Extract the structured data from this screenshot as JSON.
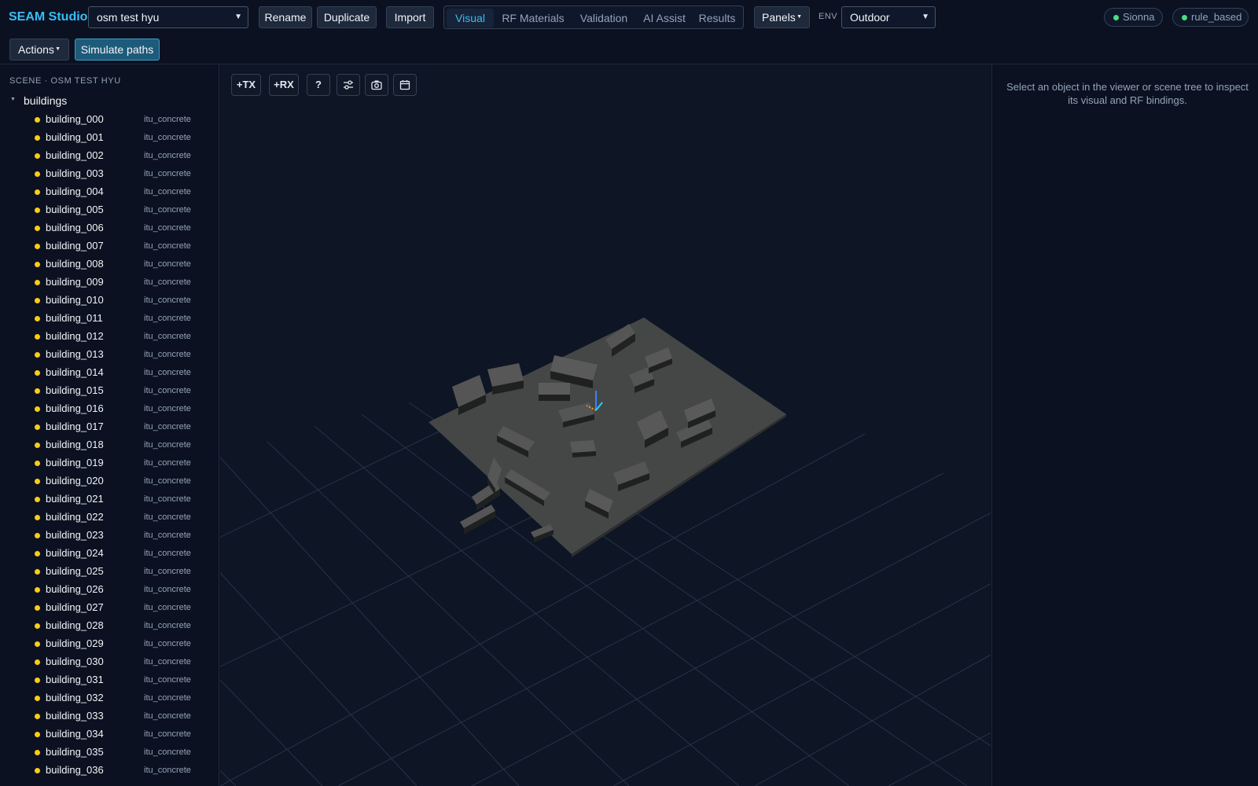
{
  "app": {
    "title": "SEAM Studio"
  },
  "scene_select": {
    "value": "osm test hyu"
  },
  "toolbar": {
    "rename": "Rename",
    "duplicate": "Duplicate",
    "import": "Import",
    "panels": "Panels",
    "actions": "Actions",
    "simulate": "Simulate paths"
  },
  "tabs": [
    {
      "label": "Visual",
      "active": true
    },
    {
      "label": "RF Materials",
      "active": false
    },
    {
      "label": "Validation",
      "active": false
    },
    {
      "label": "AI Assist",
      "active": false
    },
    {
      "label": "Results",
      "active": false
    }
  ],
  "env": {
    "label": "ENV",
    "value": "Outdoor"
  },
  "status": {
    "engine": "Sionna",
    "mode": "rule_based",
    "color": "#4ade80"
  },
  "sidebar": {
    "scene_title": "SCENE · OSM TEST HYU",
    "group": "buildings",
    "items": [
      {
        "name": "building_000",
        "material": "itu_concrete"
      },
      {
        "name": "building_001",
        "material": "itu_concrete"
      },
      {
        "name": "building_002",
        "material": "itu_concrete"
      },
      {
        "name": "building_003",
        "material": "itu_concrete"
      },
      {
        "name": "building_004",
        "material": "itu_concrete"
      },
      {
        "name": "building_005",
        "material": "itu_concrete"
      },
      {
        "name": "building_006",
        "material": "itu_concrete"
      },
      {
        "name": "building_007",
        "material": "itu_concrete"
      },
      {
        "name": "building_008",
        "material": "itu_concrete"
      },
      {
        "name": "building_009",
        "material": "itu_concrete"
      },
      {
        "name": "building_010",
        "material": "itu_concrete"
      },
      {
        "name": "building_011",
        "material": "itu_concrete"
      },
      {
        "name": "building_012",
        "material": "itu_concrete"
      },
      {
        "name": "building_013",
        "material": "itu_concrete"
      },
      {
        "name": "building_014",
        "material": "itu_concrete"
      },
      {
        "name": "building_015",
        "material": "itu_concrete"
      },
      {
        "name": "building_016",
        "material": "itu_concrete"
      },
      {
        "name": "building_017",
        "material": "itu_concrete"
      },
      {
        "name": "building_018",
        "material": "itu_concrete"
      },
      {
        "name": "building_019",
        "material": "itu_concrete"
      },
      {
        "name": "building_020",
        "material": "itu_concrete"
      },
      {
        "name": "building_021",
        "material": "itu_concrete"
      },
      {
        "name": "building_022",
        "material": "itu_concrete"
      },
      {
        "name": "building_023",
        "material": "itu_concrete"
      },
      {
        "name": "building_024",
        "material": "itu_concrete"
      },
      {
        "name": "building_025",
        "material": "itu_concrete"
      },
      {
        "name": "building_026",
        "material": "itu_concrete"
      },
      {
        "name": "building_027",
        "material": "itu_concrete"
      },
      {
        "name": "building_028",
        "material": "itu_concrete"
      },
      {
        "name": "building_029",
        "material": "itu_concrete"
      },
      {
        "name": "building_030",
        "material": "itu_concrete"
      },
      {
        "name": "building_031",
        "material": "itu_concrete"
      },
      {
        "name": "building_032",
        "material": "itu_concrete"
      },
      {
        "name": "building_033",
        "material": "itu_concrete"
      },
      {
        "name": "building_034",
        "material": "itu_concrete"
      },
      {
        "name": "building_035",
        "material": "itu_concrete"
      },
      {
        "name": "building_036",
        "material": "itu_concrete"
      }
    ]
  },
  "viewer_tools": {
    "add_tx": "+TX",
    "add_rx": "+RX",
    "help": "?"
  },
  "inspector": {
    "empty_text": "Select an object in the viewer or scene tree to inspect its visual and RF bindings."
  },
  "colors": {
    "accent": "#38bdf8",
    "building_dot": "#facc15",
    "status_ok": "#4ade80"
  }
}
